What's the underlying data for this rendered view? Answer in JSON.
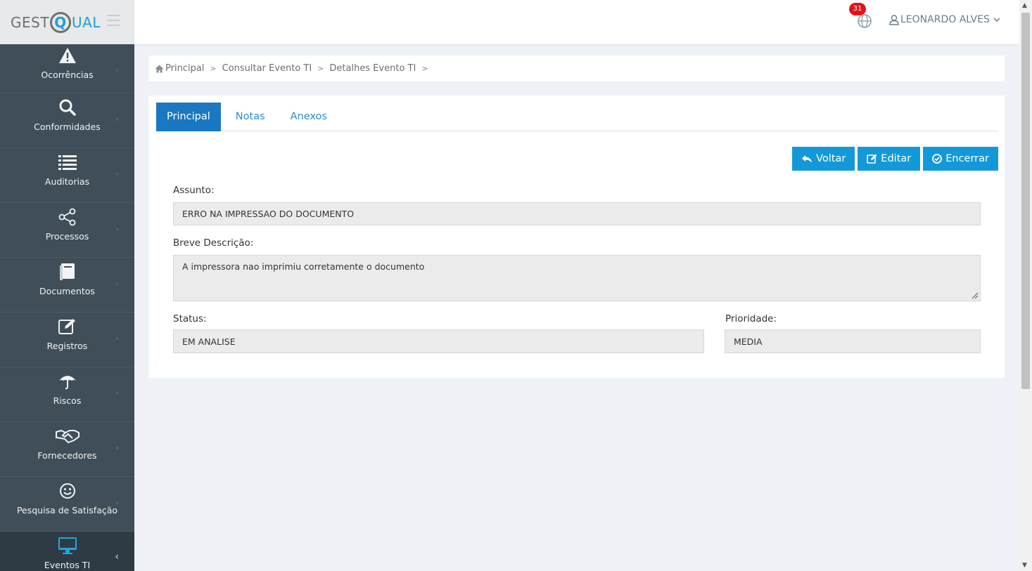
{
  "logo": {
    "text_left": "Gest",
    "text_q": "Q",
    "text_right": "ual"
  },
  "sidebar": {
    "items": [
      {
        "label": "Ocorrências",
        "icon": "warning-icon"
      },
      {
        "label": "Conformidades",
        "icon": "search-icon"
      },
      {
        "label": "Auditorias",
        "icon": "list-icon"
      },
      {
        "label": "Processos",
        "icon": "share-icon"
      },
      {
        "label": "Documentos",
        "icon": "book-icon"
      },
      {
        "label": "Registros",
        "icon": "edit-icon"
      },
      {
        "label": "Riscos",
        "icon": "umbrella-icon"
      },
      {
        "label": "Fornecedores",
        "icon": "handshake-icon"
      },
      {
        "label": "Pesquisa de Satisfação",
        "icon": "smile-icon"
      },
      {
        "label": "Eventos TI",
        "icon": "monitor-icon",
        "active": true
      }
    ]
  },
  "header": {
    "notifications_count": "31",
    "user_name": "LEONARDO ALVES"
  },
  "breadcrumb": [
    "Principal",
    "Consultar Evento TI",
    "Detalhes Evento TI"
  ],
  "tabs": [
    "Principal",
    "Notas",
    "Anexos"
  ],
  "actions": {
    "back": "Voltar",
    "edit": "Editar",
    "close": "Encerrar"
  },
  "form": {
    "subject_label": "Assunto:",
    "subject_value": "ERRO NA IMPRESSAO DO DOCUMENTO",
    "description_label": "Breve Descrição:",
    "description_value": "A impressora nao imprimiu corretamente o documento",
    "status_label": "Status:",
    "status_value": "EM ANALISE",
    "priority_label": "Prioridade:",
    "priority_value": "MEDIA"
  },
  "colors": {
    "sidebar": "#3f4e59",
    "accent": "#1499d8",
    "tab_active": "#1a78c2",
    "badge": "#e3121b"
  }
}
